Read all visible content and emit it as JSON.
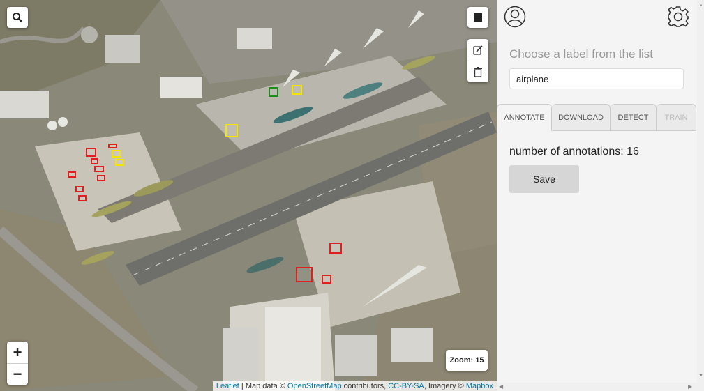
{
  "map": {
    "zoom_label": "Zoom: 15",
    "zoom_in": "+",
    "zoom_out": "−",
    "attribution": {
      "leaflet": "Leaflet",
      "sep1": " | Map data © ",
      "osm": "OpenStreetMap",
      "sep2": " contributors, ",
      "license": "CC-BY-SA",
      "sep3": ", Imagery © ",
      "mapbox": "Mapbox"
    },
    "annotation_colors": {
      "red": "#e02020",
      "yellow": "#f5e400",
      "green": "#1f8a1f"
    },
    "icons": [
      "search-icon",
      "square-icon",
      "edit-icon",
      "trash-icon"
    ]
  },
  "sidebar": {
    "label_title": "Choose a label from the list",
    "label_value": "airplane",
    "tabs": [
      {
        "label": "ANNOTATE",
        "state": "active"
      },
      {
        "label": "DOWNLOAD",
        "state": "normal"
      },
      {
        "label": "DETECT",
        "state": "normal"
      },
      {
        "label": "TRAIN",
        "state": "disabled"
      }
    ],
    "annotation_count": "number of annotations: 16",
    "save_label": "Save",
    "icons": [
      "user-icon",
      "gear-icon"
    ]
  }
}
